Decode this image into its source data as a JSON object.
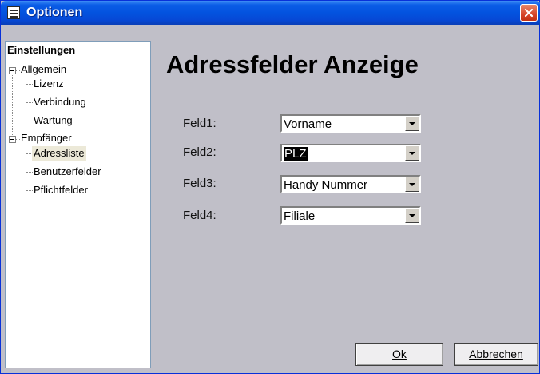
{
  "window": {
    "title": "Optionen",
    "app_icon": "form-window-icon",
    "close_icon": "close-icon",
    "close_color": "#d6442a",
    "titlebar_color": "#0353df"
  },
  "tree": {
    "root": "Einstellungen",
    "groups": [
      {
        "label": "Allgemein",
        "expanded": true,
        "children": [
          "Lizenz",
          "Verbindung",
          "Wartung"
        ]
      },
      {
        "label": "Empfänger",
        "expanded": true,
        "children": [
          "Adressliste",
          "Benutzerfelder",
          "Pflichtfelder"
        ],
        "selected": "Adressliste"
      }
    ]
  },
  "main": {
    "heading": "Adressfelder Anzeige",
    "fields": [
      {
        "label": "Feld1:",
        "value": "Vorname",
        "selected": false
      },
      {
        "label": "Feld2:",
        "value": "PLZ",
        "selected": true
      },
      {
        "label": "Feld3:",
        "value": "Handy Nummer",
        "selected": false
      },
      {
        "label": "Feld4:",
        "value": "Filiale",
        "selected": false
      }
    ]
  },
  "buttons": {
    "ok_label": "Ok",
    "cancel_label": "Abbrechen"
  }
}
